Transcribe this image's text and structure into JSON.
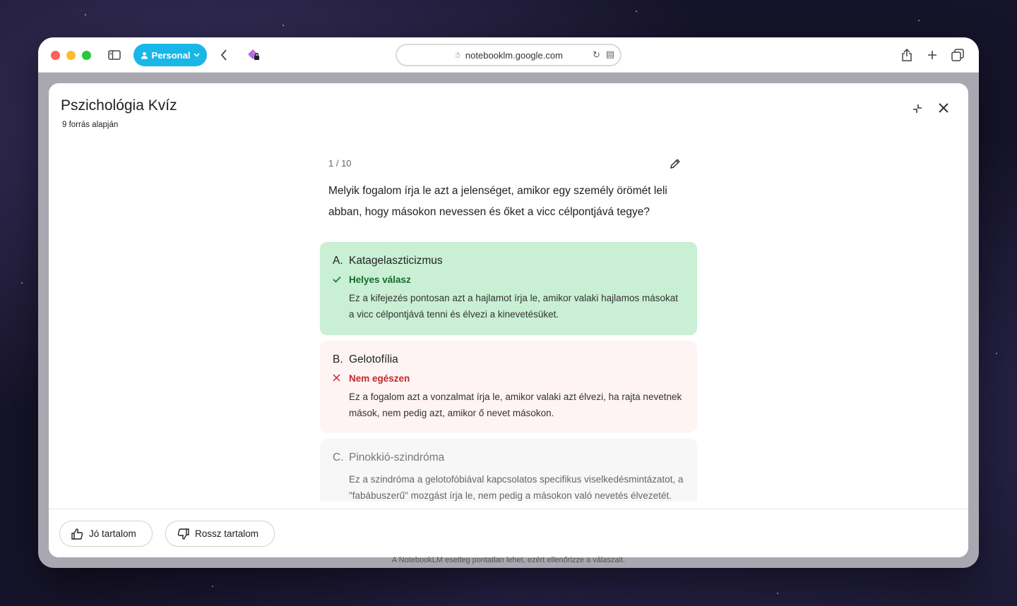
{
  "browser": {
    "profile_label": "Personal",
    "url": "notebooklm.google.com"
  },
  "modal": {
    "title": "Pszichológia Kvíz",
    "subtitle": "9 forrás alapján"
  },
  "quiz": {
    "counter": "1 / 10",
    "question": "Melyik fogalom írja le azt a jelenséget, amikor egy személy örömét leli abban, hogy másokon nevessen és őket a vicc célpontjává tegye?",
    "options": [
      {
        "letter": "A.",
        "label": "Katagelaszticizmus",
        "status": "Helyes válasz",
        "explanation": "Ez a kifejezés pontosan azt a hajlamot írja le, amikor valaki hajlamos másokat a vicc célpontjává tenni és élvezi a kinevetésüket."
      },
      {
        "letter": "B.",
        "label": "Gelotofília",
        "status": "Nem egészen",
        "explanation": "Ez a fogalom azt a vonzalmat írja le, amikor valaki azt élvezi, ha rajta nevetnek mások, nem pedig azt, amikor ő nevet másokon."
      },
      {
        "letter": "C.",
        "label": "Pinokkió-szindróma",
        "status": "",
        "explanation": "Ez a szindróma a gelotofóbiával kapcsolatos specifikus viselkedésmintázatot, a \"fabábuszerű\" mozgást írja le, nem pedig a másokon való nevetés élvezetét."
      }
    ]
  },
  "footer": {
    "good_label": "Jó tartalom",
    "bad_label": "Rossz tartalom"
  },
  "disclaimer": "A NotebookLM esetleg pontatlan lehet, ezért ellenőrizze a válaszait.",
  "colors": {
    "profile_accent": "#19b6e8",
    "correct_bg": "#c9efd4",
    "correct_text": "#146c2e",
    "wrong_bg": "#fdf4f3",
    "wrong_text": "#c0282d"
  }
}
